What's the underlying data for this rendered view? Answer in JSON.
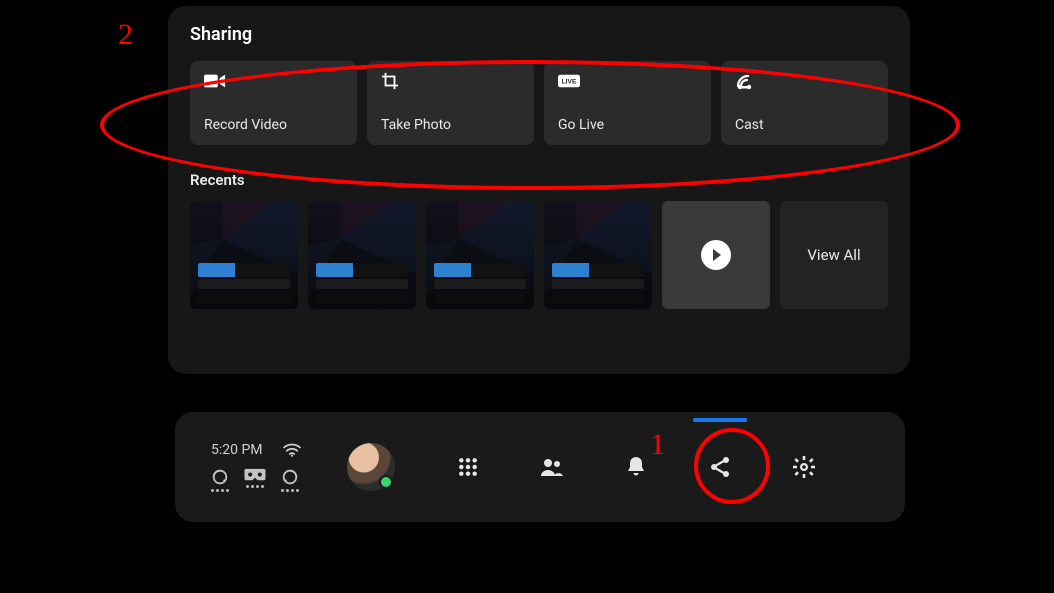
{
  "panel": {
    "title": "Sharing",
    "actions": [
      {
        "label": "Record Video"
      },
      {
        "label": "Take Photo"
      },
      {
        "label": "Go Live"
      },
      {
        "label": "Cast"
      }
    ],
    "recents_title": "Recents",
    "view_all_label": "View All"
  },
  "dock": {
    "time": "5:20 PM"
  },
  "annotations": {
    "one": "1",
    "two": "2"
  }
}
